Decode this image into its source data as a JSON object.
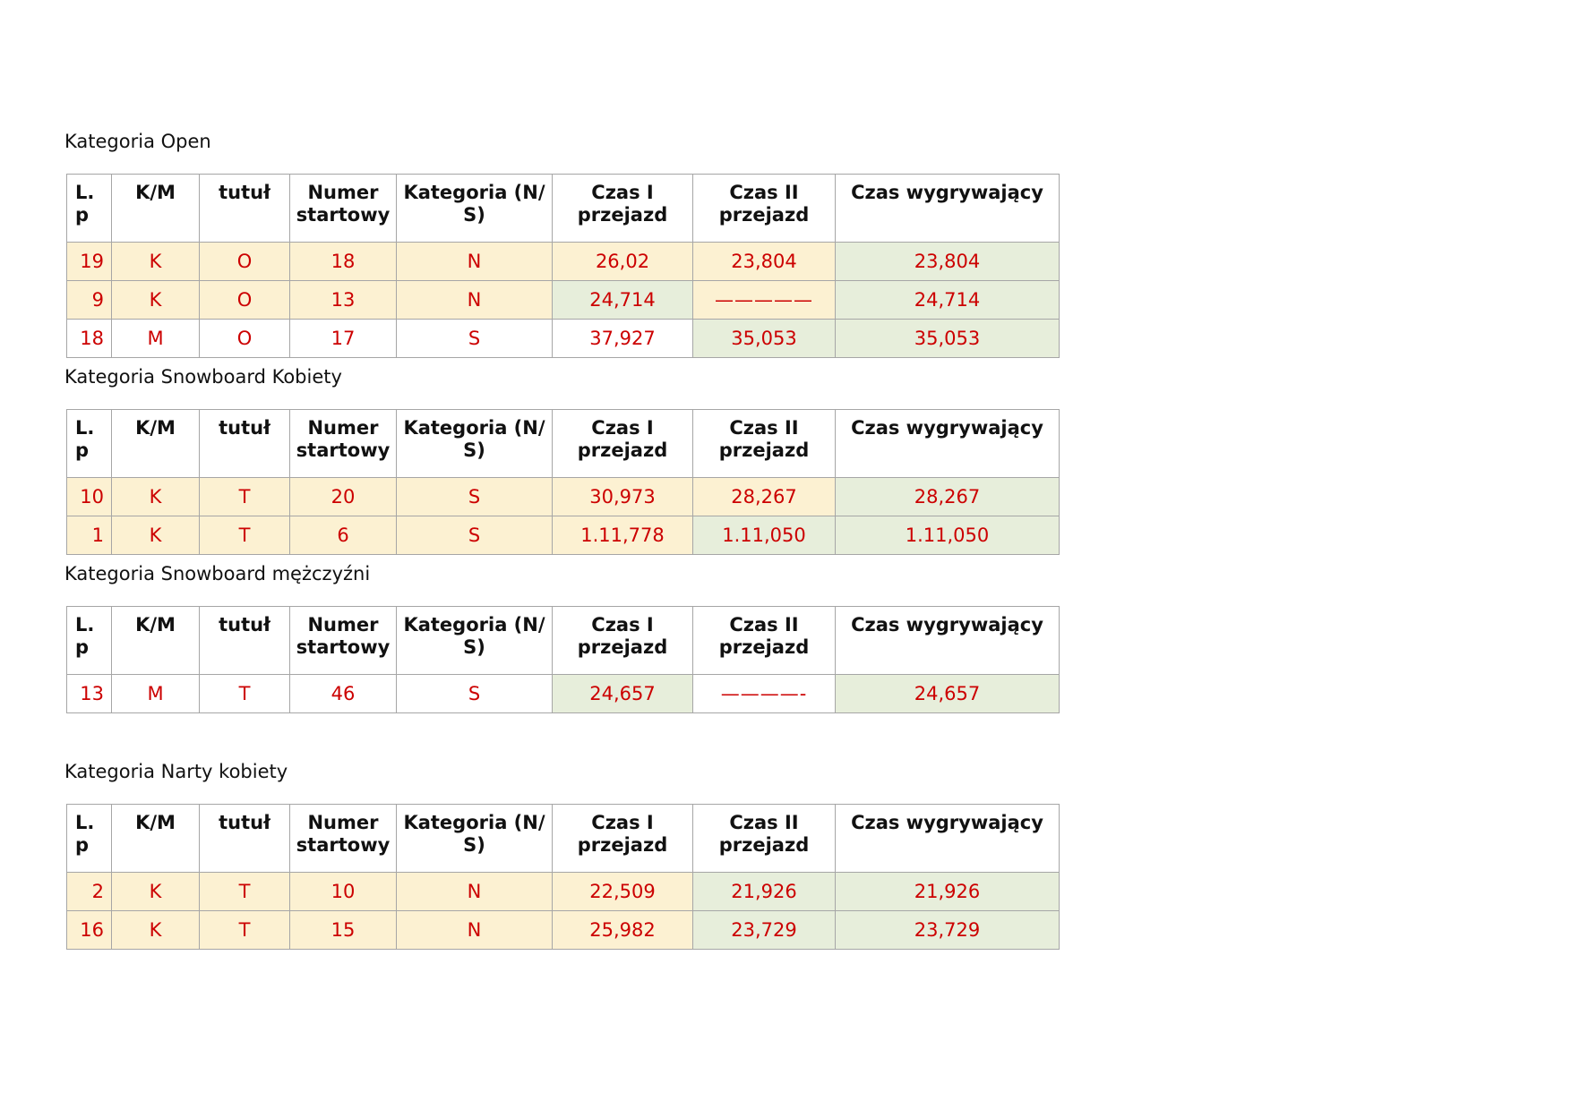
{
  "headers": {
    "lp": "L. p",
    "km": "K/M",
    "tytul": "tutuł",
    "numer": "Numer startowy",
    "kategoria": "Kategoria (N/ S)",
    "czas1": "Czas I przejazd",
    "czas2": "Czas II przejazd",
    "czas_wyg": "Czas wygrywający"
  },
  "sections": [
    {
      "title": "Kategoria Open",
      "rows": [
        [
          "19",
          "K",
          "O",
          "18",
          "N",
          "26,02",
          "23,804",
          "23,804"
        ],
        [
          "9",
          "K",
          "O",
          "13",
          "N",
          "24,714",
          "—————",
          "24,714"
        ],
        [
          "18",
          "M",
          "O",
          "17",
          "S",
          "37,927",
          "35,053",
          "35,053"
        ]
      ]
    },
    {
      "title": "Kategoria Snowboard Kobiety",
      "rows": [
        [
          "10",
          "K",
          "T",
          "20",
          "S",
          "30,973",
          "28,267",
          "28,267"
        ],
        [
          "1",
          "K",
          "T",
          "6",
          "S",
          "1.11,778",
          "1.11,050",
          "1.11,050"
        ]
      ]
    },
    {
      "title": "Kategoria Snowboard mężczyźni",
      "rows": [
        [
          "13",
          "M",
          "T",
          "46",
          "S",
          "24,657",
          "————-",
          "24,657"
        ]
      ]
    },
    {
      "title": "Kategoria Narty kobiety",
      "rows": [
        [
          "2",
          "K",
          "T",
          "10",
          "N",
          "22,509",
          "21,926",
          "21,926"
        ],
        [
          "16",
          "K",
          "T",
          "15",
          "N",
          "25,982",
          "23,729",
          "23,729"
        ]
      ]
    }
  ]
}
